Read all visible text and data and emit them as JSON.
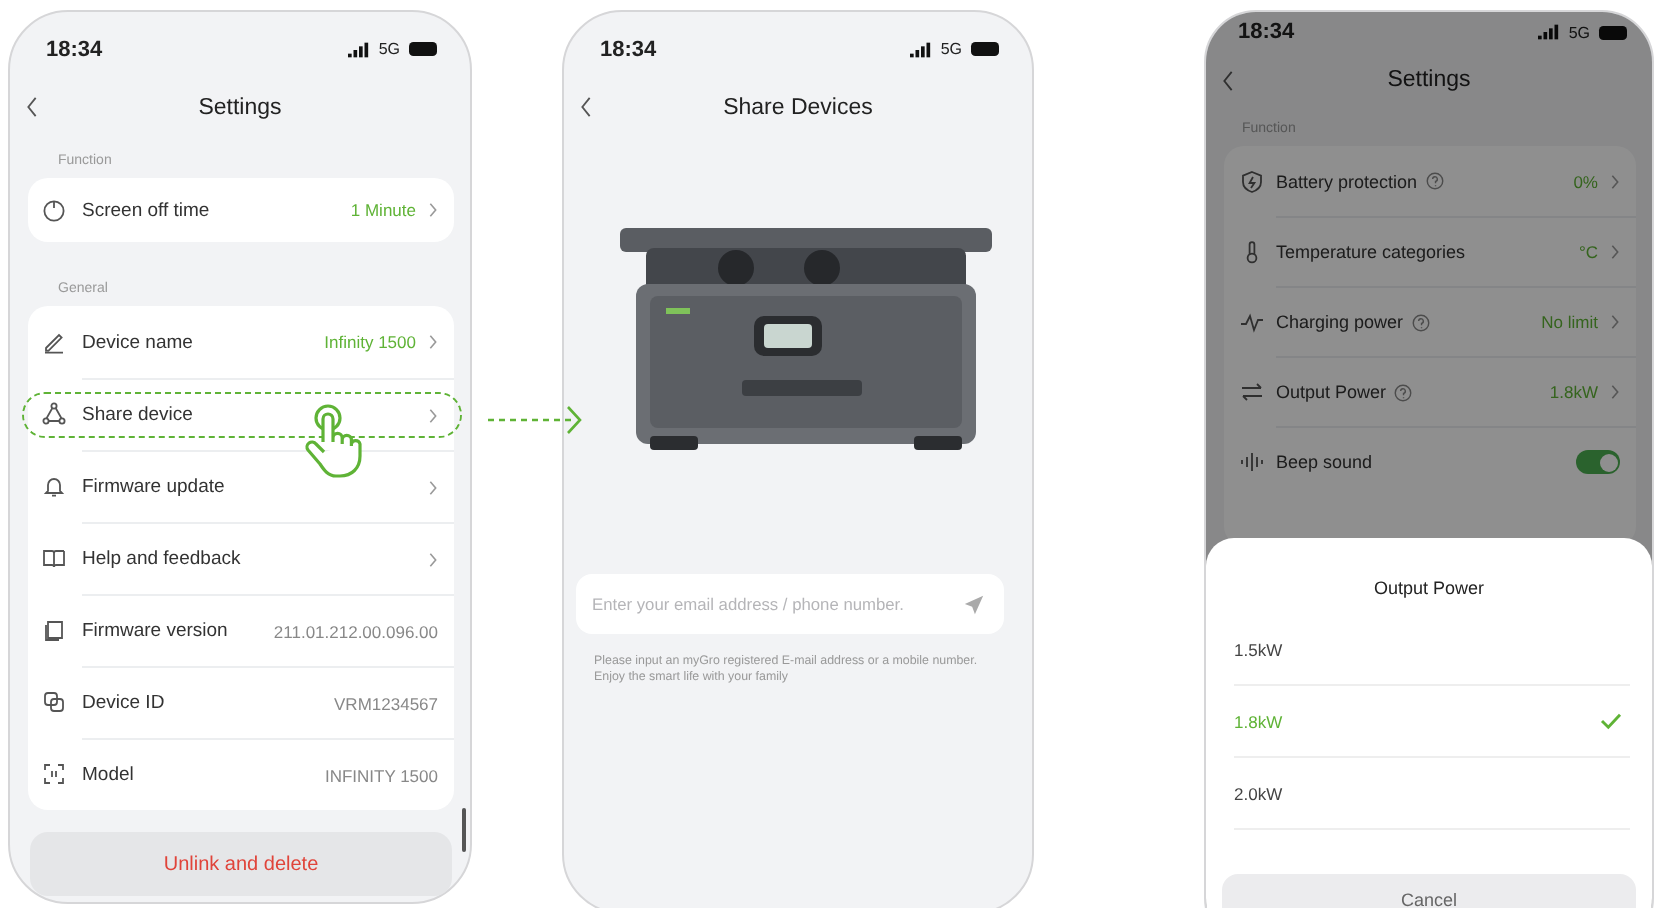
{
  "settings_screen": {
    "status_bar": {
      "time": "18:34",
      "network": "5G"
    },
    "title": "Settings",
    "sections": [
      {
        "header": "Function",
        "rows": [
          {
            "label": "Screen off time",
            "value": "1 Minute",
            "kind": "link",
            "tapped": false
          }
        ]
      },
      {
        "header": "General",
        "rows": [
          {
            "label": "Device name",
            "value": "Infinity 1500",
            "kind": "link",
            "tapped": false
          },
          {
            "label": "Share device",
            "kind": "link",
            "tapped": true
          },
          {
            "label": "Firmware update",
            "kind": "link",
            "tapped": false
          },
          {
            "label": "Help and feedback",
            "kind": "link",
            "tapped": false
          },
          {
            "label": "Firmware version",
            "value": "211.01.212.00.096.00",
            "kind": "info",
            "tapped": false
          },
          {
            "label": "Device ID",
            "value": "VRM1234567",
            "kind": "info",
            "tapped": false
          },
          {
            "label": "Model",
            "value": "INFINITY 1500",
            "kind": "info",
            "tapped": false
          }
        ]
      }
    ],
    "danger_button": "Unlink and delete"
  },
  "share_screen": {
    "status_bar": {
      "time": "18:34",
      "network": "5G"
    },
    "title": "Share Devices",
    "invite_field": {
      "placeholder": "Enter your email address / phone number."
    },
    "hint": "Please input an myGro registered E-mail address or a mobile number. Enjoy the smart life with your family"
  },
  "output_power_screen": {
    "status_bar": {
      "time": "18:34",
      "network": "5G"
    },
    "title": "Settings",
    "section_header": "Function",
    "rows": [
      {
        "label": "Battery protection",
        "help": true,
        "value": "0%",
        "kind": "link"
      },
      {
        "label": "Temperature categories",
        "help": false,
        "value": "°C",
        "kind": "link"
      },
      {
        "label": "Charging power",
        "help": true,
        "value": "No limit",
        "kind": "link"
      },
      {
        "label": "Output Power",
        "help": true,
        "value": "1.8kW",
        "kind": "link"
      },
      {
        "label": "Beep sound",
        "help": false,
        "kind": "toggle",
        "on": true
      }
    ],
    "sheet": {
      "title": "Output Power",
      "options": [
        {
          "label": "1.5kW",
          "selected": false
        },
        {
          "label": "1.8kW",
          "selected": true
        },
        {
          "label": "2.0kW",
          "selected": false
        }
      ],
      "cancel": "Cancel"
    }
  }
}
